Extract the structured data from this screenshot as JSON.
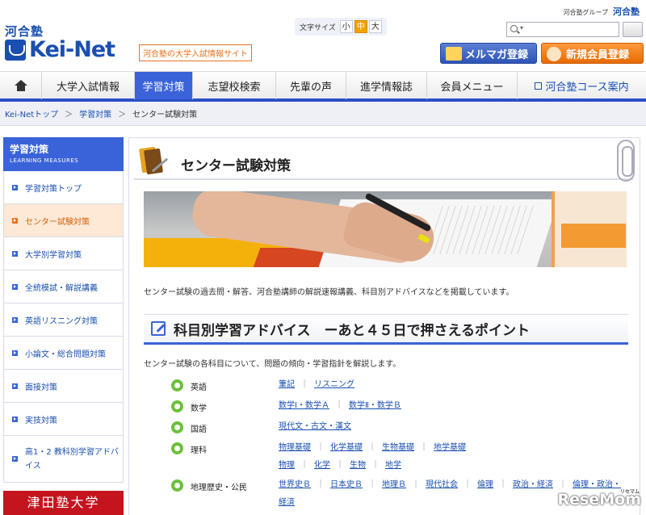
{
  "header": {
    "group_label": "河合塾グループ",
    "group_brand": "河合塾",
    "logo_kanji": "河合塾",
    "logo_text": "Kei-Net",
    "tagline": "河合塾の大学入試情報サイト",
    "fontsize_label": "文字サイズ",
    "fontsize_small": "小",
    "fontsize_medium": "中",
    "fontsize_large": "大",
    "search_dropdown": "▾",
    "mailmag_button": "メルマガ登録",
    "register_button": "新規会員登録"
  },
  "nav": {
    "items": [
      {
        "label": "大学入試情報"
      },
      {
        "label": "学習対策"
      },
      {
        "label": "志望校検索"
      },
      {
        "label": "先輩の声"
      },
      {
        "label": "進学情報誌"
      },
      {
        "label": "会員メニュー"
      },
      {
        "label": "河合塾コース案内"
      }
    ],
    "active_index": 1
  },
  "breadcrumb": {
    "items": [
      "Kei-Netトップ",
      "学習対策",
      "センター試験対策"
    ],
    "separator": "＞"
  },
  "sidebar": {
    "title": "学習対策",
    "subtitle": "LEARNING MEASURES",
    "items": [
      {
        "label": "学習対策トップ"
      },
      {
        "label": "センター試験対策"
      },
      {
        "label": "大学別学習対策"
      },
      {
        "label": "全統模試・解説講義"
      },
      {
        "label": "英語リスニング対策"
      },
      {
        "label": "小論文・総合問題対策"
      },
      {
        "label": "面接対策"
      },
      {
        "label": "実技対策"
      },
      {
        "label": "高1・2 教科別学習アドバイス"
      }
    ],
    "active_index": 1,
    "banner": "津田塾大学"
  },
  "main": {
    "page_title": "センター試験対策",
    "intro": "センター試験の過去問・解答、河合塾講師の解説速報講義、科目別アドバイスなどを掲載しています。",
    "section_title": "科目別学習アドバイス　ーあと４５日で押さえるポイント",
    "section_desc": "センター試験の各科目について、問題の傾向・学習指針を解説します。",
    "subjects": [
      {
        "name": "英語",
        "links": [
          "筆記",
          "リスニング"
        ]
      },
      {
        "name": "数学",
        "links": [
          "数学Ⅰ・数学Ａ",
          "数学Ⅱ・数学Ｂ"
        ]
      },
      {
        "name": "国語",
        "links": [
          "現代文・古文・漢文"
        ]
      },
      {
        "name": "理科",
        "links": [
          "物理基礎",
          "化学基礎",
          "生物基礎",
          "地学基礎",
          "物理",
          "化学",
          "生物",
          "地学"
        ]
      },
      {
        "name": "地理歴史・公民",
        "links": [
          "世界史Ｂ",
          "日本史Ｂ",
          "地理Ｂ",
          "現代社会",
          "倫理",
          "政治・経済",
          "倫理・政治・経済"
        ]
      }
    ]
  },
  "watermark": {
    "text": "ReseMom",
    "small": "リセマム"
  },
  "colors": {
    "primary": "#3a63d9",
    "accent": "#e8731f",
    "link": "#1a4fb0",
    "bullet": "#6cc03a"
  }
}
